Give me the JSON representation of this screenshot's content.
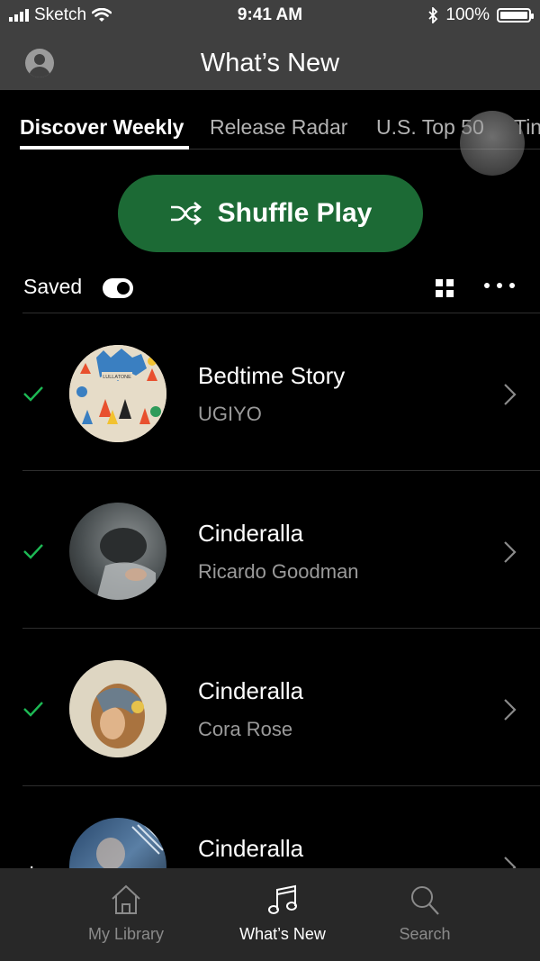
{
  "status_bar": {
    "carrier": "Sketch",
    "time": "9:41 AM",
    "battery": "100%",
    "battery_level": 1.0
  },
  "nav": {
    "title": "What’s New"
  },
  "tabs": [
    {
      "label": "Discover Weekly",
      "active": true
    },
    {
      "label": "Release Radar",
      "active": false
    },
    {
      "label": "U.S. Top 50",
      "active": false
    },
    {
      "label": "Tin",
      "active": false
    }
  ],
  "shuffle": {
    "label": "Shuffle Play"
  },
  "saved": {
    "label": "Saved",
    "on": true
  },
  "tracks": [
    {
      "title": "Bedtime Story",
      "artist": "UGIYO",
      "art_label": "LULLATONE",
      "saved": true
    },
    {
      "title": "Cinderalla",
      "artist": "Ricardo Goodman",
      "saved": true
    },
    {
      "title": "Cinderalla",
      "artist": "Cora Rose",
      "saved": true
    },
    {
      "title": "Cinderalla",
      "artist": "",
      "saved": false
    }
  ],
  "bottom_tabs": [
    {
      "label": "My Library",
      "icon": "home-icon",
      "active": false
    },
    {
      "label": "What’s New",
      "icon": "music-note-icon",
      "active": true
    },
    {
      "label": "Search",
      "icon": "search-icon",
      "active": false
    }
  ],
  "colors": {
    "accent": "#1db954",
    "shuffle_button": "#1c6a35",
    "background": "#000000",
    "bar": "#404040"
  }
}
